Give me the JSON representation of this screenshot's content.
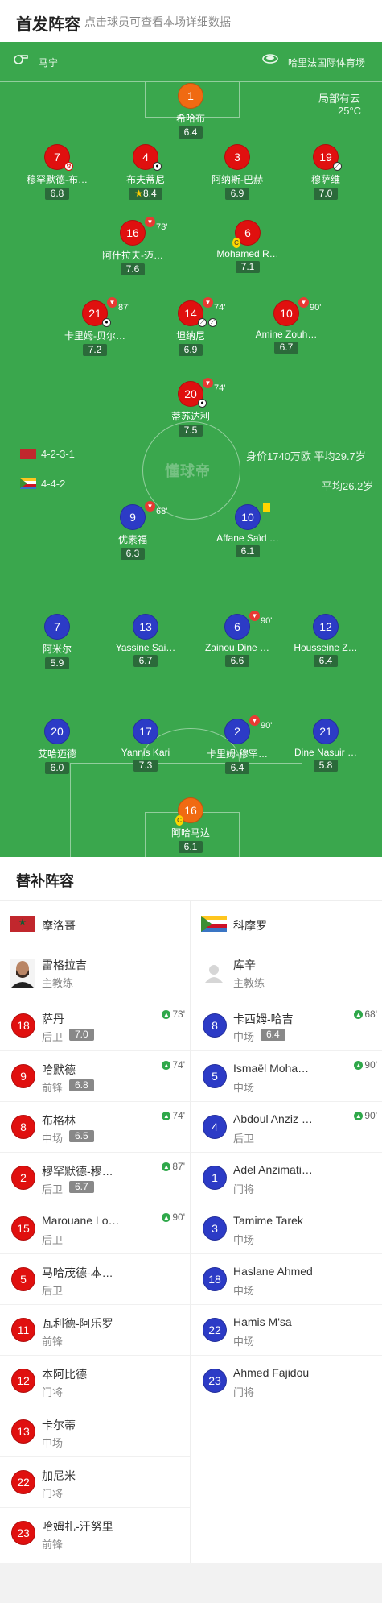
{
  "header": {
    "title": "首发阵容",
    "subtitle": "点击球员可查看本场详细数据"
  },
  "pitch": {
    "referee": "马宁",
    "stadium": "哈里法国际体育场",
    "weather": "局部有云",
    "temperature": "25°C",
    "watermark": "懂球帝",
    "home": {
      "formation": "4-2-3-1",
      "stats": "身价1740万欧 平均29.7岁"
    },
    "away": {
      "formation": "4-4-2",
      "stats": "平均26.2岁"
    }
  },
  "home_players": [
    {
      "num": "1",
      "name": "希哈布",
      "rating": "6.4"
    },
    {
      "num": "7",
      "name": "穆罕默德-布…",
      "rating": "6.8"
    },
    {
      "num": "4",
      "name": "布夫蒂尼",
      "rating": "8.4"
    },
    {
      "num": "3",
      "name": "阿纳斯-巴赫",
      "rating": "6.9"
    },
    {
      "num": "19",
      "name": "穆萨维",
      "rating": "7.0"
    },
    {
      "num": "16",
      "name": "阿什拉夫-迈…",
      "rating": "7.6",
      "sub": "73'"
    },
    {
      "num": "6",
      "name": "Mohamed R…",
      "rating": "7.1"
    },
    {
      "num": "21",
      "name": "卡里姆-贝尔…",
      "rating": "7.2",
      "sub": "87'"
    },
    {
      "num": "14",
      "name": "坦纳尼",
      "rating": "6.9",
      "sub": "74'"
    },
    {
      "num": "10",
      "name": "Amine Zouh…",
      "rating": "6.7",
      "sub": "90'"
    },
    {
      "num": "20",
      "name": "蒂苏达利",
      "rating": "7.5",
      "sub": "74'"
    }
  ],
  "away_players": [
    {
      "num": "9",
      "name": "优素福",
      "rating": "6.3",
      "sub": "68'"
    },
    {
      "num": "10",
      "name": "Affane Saïd …",
      "rating": "6.1"
    },
    {
      "num": "7",
      "name": "阿米尔",
      "rating": "5.9"
    },
    {
      "num": "13",
      "name": "Yassine Sai…",
      "rating": "6.7"
    },
    {
      "num": "6",
      "name": "Zainou Dine …",
      "rating": "6.6",
      "sub": "90'"
    },
    {
      "num": "12",
      "name": "Housseine Z…",
      "rating": "6.4"
    },
    {
      "num": "20",
      "name": "艾哈迈德",
      "rating": "6.0"
    },
    {
      "num": "17",
      "name": "Yannis Kari",
      "rating": "7.3"
    },
    {
      "num": "2",
      "name": "卡里姆-穆罕…",
      "rating": "6.4",
      "sub": "90'"
    },
    {
      "num": "21",
      "name": "Dine Nasuir …",
      "rating": "5.8"
    },
    {
      "num": "16",
      "name": "阿哈马达",
      "rating": "6.1"
    }
  ],
  "subs": {
    "title": "替补阵容",
    "home": {
      "team": "摩洛哥",
      "coach": {
        "name": "雷格拉吉",
        "role": "主教练"
      },
      "list": [
        {
          "num": "18",
          "name": "萨丹",
          "pos": "后卫",
          "rating": "7.0",
          "in": "73'"
        },
        {
          "num": "9",
          "name": "哈默德",
          "pos": "前锋",
          "rating": "6.8",
          "in": "74'"
        },
        {
          "num": "8",
          "name": "布格林",
          "pos": "中场",
          "rating": "6.5",
          "in": "74'"
        },
        {
          "num": "2",
          "name": "穆罕默德-穆…",
          "pos": "后卫",
          "rating": "6.7",
          "in": "87'"
        },
        {
          "num": "15",
          "name": "Marouane Lo…",
          "pos": "后卫",
          "in": "90'"
        },
        {
          "num": "5",
          "name": "马哈茂德-本…",
          "pos": "后卫"
        },
        {
          "num": "11",
          "name": "瓦利德-阿乐罗",
          "pos": "前锋"
        },
        {
          "num": "12",
          "name": "本阿比德",
          "pos": "门将"
        },
        {
          "num": "13",
          "name": "卡尔蒂",
          "pos": "中场"
        },
        {
          "num": "22",
          "name": "加尼米",
          "pos": "门将"
        },
        {
          "num": "23",
          "name": "哈姆扎-汗努里",
          "pos": "前锋"
        }
      ]
    },
    "away": {
      "team": "科摩罗",
      "coach": {
        "name": "库辛",
        "role": "主教练"
      },
      "list": [
        {
          "num": "8",
          "name": "卡西姆-哈吉",
          "pos": "中场",
          "rating": "6.4",
          "in": "68'"
        },
        {
          "num": "5",
          "name": "Ismaël Moha…",
          "pos": "中场",
          "in": "90'"
        },
        {
          "num": "4",
          "name": "Abdoul Anziz …",
          "pos": "后卫",
          "in": "90'"
        },
        {
          "num": "1",
          "name": "Adel Anzimati…",
          "pos": "门将"
        },
        {
          "num": "3",
          "name": "Tamime Tarek",
          "pos": "中场"
        },
        {
          "num": "18",
          "name": "Haslane Ahmed",
          "pos": "中场"
        },
        {
          "num": "22",
          "name": "Hamis M'sa",
          "pos": "中场"
        },
        {
          "num": "23",
          "name": "Ahmed Fajidou",
          "pos": "门将"
        }
      ]
    }
  },
  "colors": {
    "home": "#e0100f",
    "away": "#2c3bc6",
    "keeper": "#f06a12",
    "pitch": "#3aa74d"
  }
}
